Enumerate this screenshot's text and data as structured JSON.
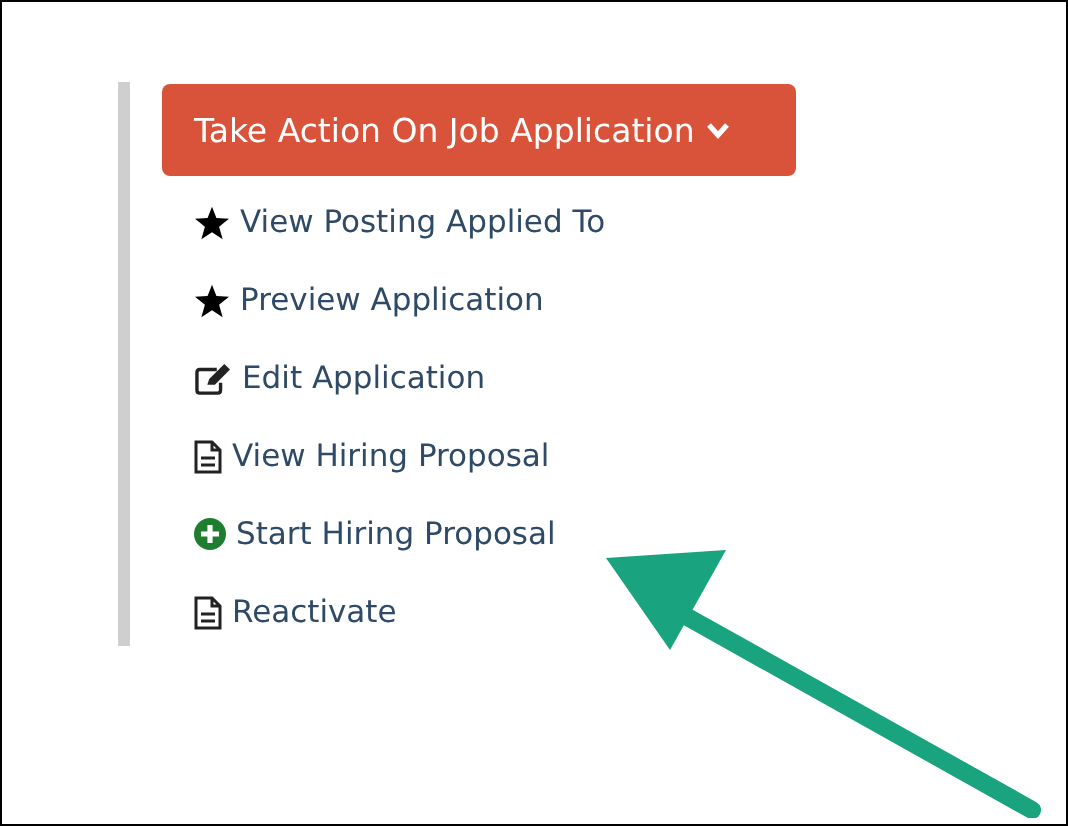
{
  "action_button": {
    "label": "Take Action On Job Application"
  },
  "menu_items": [
    {
      "kind": "star",
      "label": "View Posting Applied To"
    },
    {
      "kind": "star",
      "label": "Preview Application"
    },
    {
      "kind": "edit",
      "label": "Edit Application"
    },
    {
      "kind": "document",
      "label": "View Hiring Proposal"
    },
    {
      "kind": "add",
      "label": "Start Hiring Proposal"
    },
    {
      "kind": "document",
      "label": "Reactivate"
    }
  ]
}
